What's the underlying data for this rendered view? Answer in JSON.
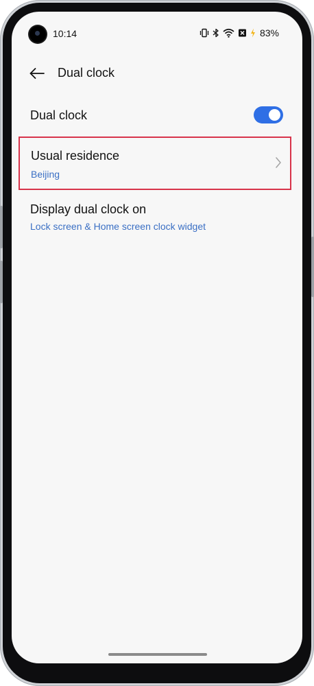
{
  "status_bar": {
    "time": "10:14",
    "battery_percent": "83%",
    "icons": [
      "vibrate-icon",
      "bluetooth-icon",
      "wifi-icon",
      "no-sim-icon",
      "battery-charging-icon"
    ]
  },
  "header": {
    "title": "Dual clock",
    "back_icon": "arrow-left-icon"
  },
  "settings": {
    "dual_clock": {
      "label": "Dual clock",
      "enabled": true
    },
    "usual_residence": {
      "label": "Usual residence",
      "value": "Beijing"
    },
    "display_on": {
      "label": "Display dual clock on",
      "value": "Lock screen & Home screen clock widget"
    }
  },
  "colors": {
    "accent": "#2f6fe5",
    "subtitle": "#3a6fc4",
    "highlight": "#d8334a",
    "background": "#f7f7f7"
  }
}
